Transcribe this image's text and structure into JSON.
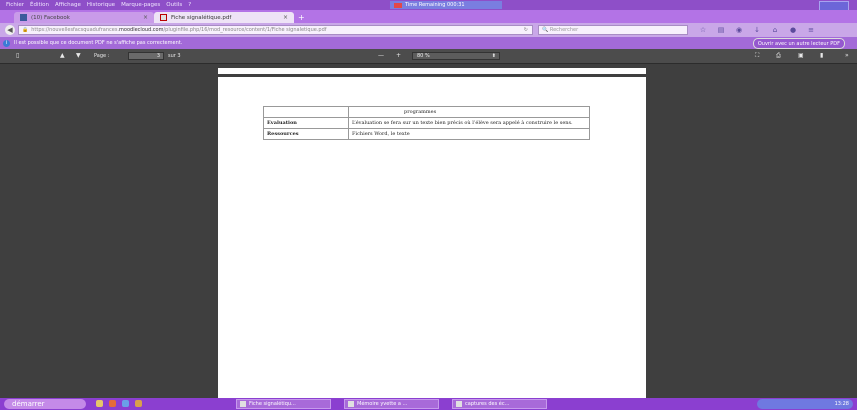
{
  "menubar": {
    "items": [
      "Fichier",
      "Édition",
      "Affichage",
      "Historique",
      "Marque-pages",
      "Outils",
      "?"
    ],
    "timer": "Time Remaining 000:31"
  },
  "tabs": [
    {
      "label": "(10) Facebook",
      "close": "×"
    },
    {
      "label": "Fiche signalétique.pdf",
      "close": "×"
    }
  ],
  "newtab": "+",
  "nav": {
    "url_prefix": "https://nouvellesfacsquadufrances.",
    "url_domain": "moodlecloud.com",
    "url_rest": "/pluginfile.php/16/mod_resource/content/1/Fiche signaletique.pdf",
    "search_placeholder": "Rechercher"
  },
  "notification": {
    "text": "Il est possible que ce document PDF ne s'affiche pas correctement.",
    "button": "Ouvrir avec un autre lecteur PDF"
  },
  "pdf_toolbar": {
    "page_label": "Page :",
    "page_value": "3",
    "page_total": "sur 3",
    "zoom_value": "80 %"
  },
  "document": {
    "rows": [
      {
        "label": "",
        "value": "programmes"
      },
      {
        "label": "Evaluation",
        "value": "L’évaluation se fera sur un texte bien précis où l’élève sera appelé à construire le sens."
      },
      {
        "label": "Ressources",
        "value": "Fichiers Word, le texte"
      }
    ]
  },
  "taskbar": {
    "start": "démarrer",
    "tasks": [
      "Fiche signalétiqu...",
      "Mémoire yvette a ...",
      "captures des éc..."
    ],
    "clock": "13:28"
  }
}
